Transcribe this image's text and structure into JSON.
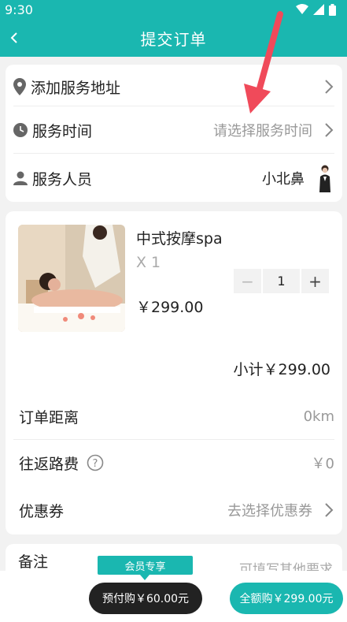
{
  "status_bar": {
    "time": "9:30"
  },
  "header": {
    "title": "提交订单"
  },
  "service": {
    "address_label": "添加服务地址",
    "time_label": "服务时间",
    "time_placeholder": "请选择服务时间",
    "staff_label": "服务人员",
    "staff_name": "小北鼻"
  },
  "product": {
    "name": "中式按摩spa",
    "quantity_text": "X 1",
    "price": "￥299.00",
    "stepper_value": "1",
    "stepper_minus": "−",
    "stepper_plus": "+"
  },
  "summary": {
    "subtotal": "小计￥299.00",
    "distance_label": "订单距离",
    "distance_value": "0km",
    "travel_fee_label": "往返路费",
    "travel_fee_value": "￥0",
    "coupon_label": "优惠券",
    "coupon_value": "去选择优惠券"
  },
  "remark": {
    "label": "备注",
    "placeholder": "可填写其他要求"
  },
  "footer": {
    "member_tag": "会员专享",
    "prepay_button": "预付购￥60.00元",
    "full_button": "全额购￥299.00元"
  },
  "colors": {
    "accent": "#1ab7b0",
    "dark_button": "#222222",
    "annotation_arrow": "#f04a5a"
  }
}
